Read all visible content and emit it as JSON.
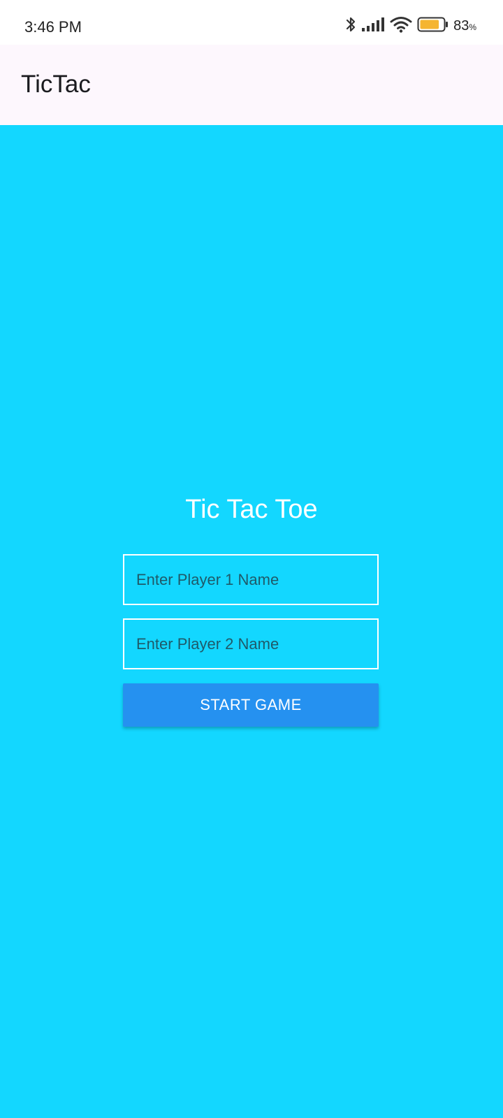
{
  "status_bar": {
    "time": "3:46 PM",
    "battery_percent": "83",
    "battery_unit": "%",
    "icons": [
      "bluetooth-icon",
      "signal-icon",
      "wifi-icon",
      "battery-icon"
    ],
    "battery_level": 0.83,
    "battery_color": "#f5b531"
  },
  "app_bar": {
    "title": "TicTac",
    "background": "#fdf7fd"
  },
  "main": {
    "background": "#13d7ff",
    "title": "Tic Tac Toe",
    "player1": {
      "placeholder": "Enter Player 1 Name",
      "value": ""
    },
    "player2": {
      "placeholder": "Enter Player 2 Name",
      "value": ""
    },
    "start_button_label": "START GAME",
    "start_button_color": "#2591f0"
  }
}
